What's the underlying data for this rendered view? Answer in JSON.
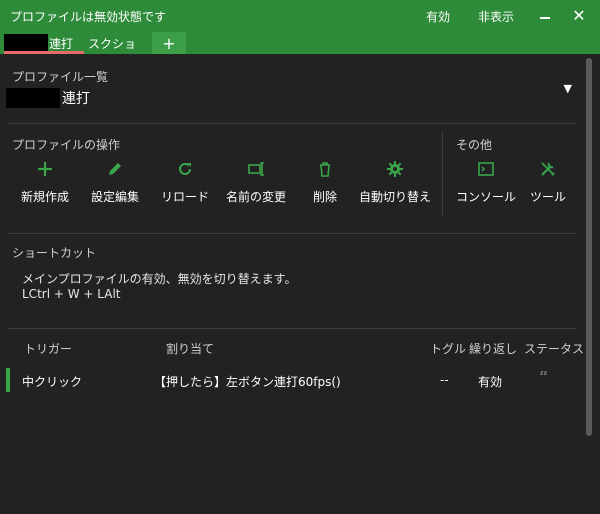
{
  "window": {
    "title": "プロファイルは無効状態です",
    "enable_label": "有効",
    "hide_label": "非表示"
  },
  "tabs": [
    {
      "label": "連打",
      "active": true
    },
    {
      "label": "スクショ",
      "active": false
    }
  ],
  "tab_add_label": "+",
  "profile_list": {
    "label": "プロファイル一覧",
    "selected": "連打"
  },
  "operations": {
    "label": "プロファイルの操作",
    "items": [
      {
        "label": "新規作成",
        "icon": "plus-icon"
      },
      {
        "label": "設定編集",
        "icon": "pencil-icon"
      },
      {
        "label": "リロード",
        "icon": "reload-icon"
      },
      {
        "label": "名前の変更",
        "icon": "rename-icon"
      },
      {
        "label": "削除",
        "icon": "trash-icon"
      },
      {
        "label": "自動切り替え",
        "icon": "gear-icon"
      }
    ]
  },
  "others": {
    "label": "その他",
    "items": [
      {
        "label": "コンソール",
        "icon": "console-icon"
      },
      {
        "label": "ツール",
        "icon": "tools-icon"
      }
    ]
  },
  "shortcut": {
    "label": "ショートカット",
    "description": "メインプロファイルの有効、無効を切り替えます。",
    "keys": "LCtrl + W + LAlt"
  },
  "table": {
    "headers": {
      "trigger": "トリガー",
      "assignment": "割り当て",
      "toggle": "トグル",
      "repeat": "繰り返し",
      "status": "ステータス"
    },
    "rows": [
      {
        "trigger": "中クリック",
        "assignment": "【押したら】左ボタン連打60fps()",
        "toggle": "--",
        "repeat": "有効",
        "status_icon": "sleep-icon"
      }
    ]
  },
  "colors": {
    "accent": "#2e8b3a",
    "icon_green": "#3aa64a",
    "tab_underline": "#e96a6a",
    "background": "#222222"
  }
}
